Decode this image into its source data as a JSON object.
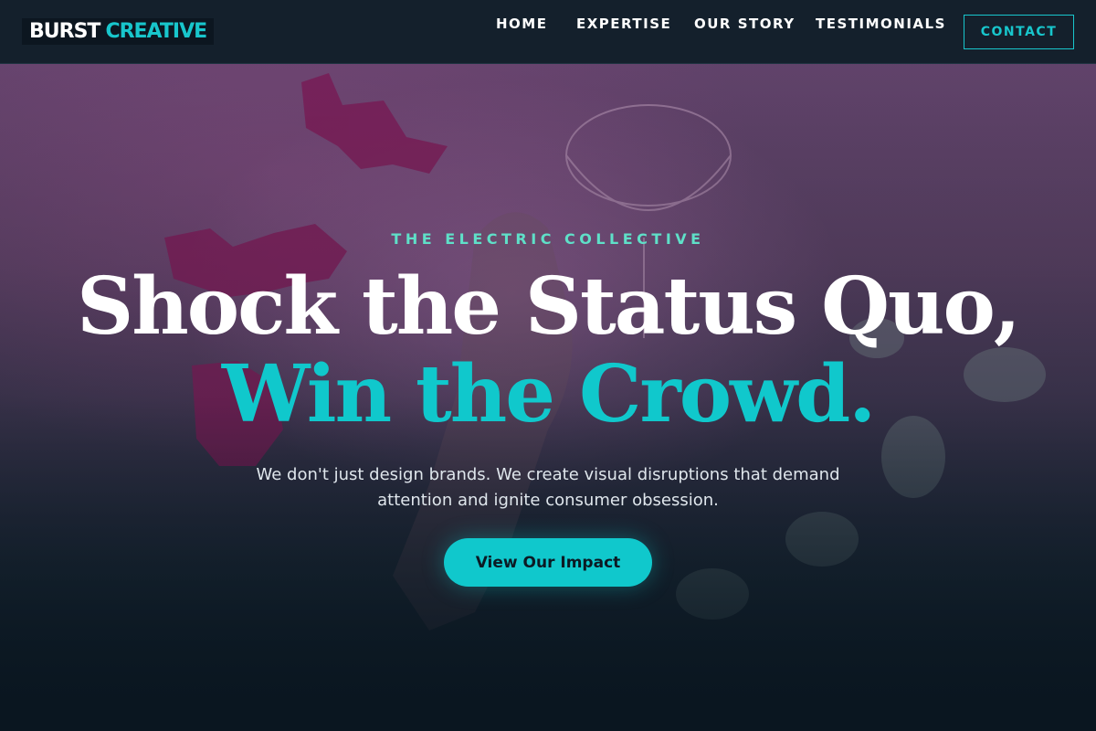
{
  "brand": {
    "logo_word1": "BURST",
    "logo_word2": "CREATIVE"
  },
  "nav": {
    "items": [
      {
        "label": "HOME"
      },
      {
        "label": "EXPERTISE"
      },
      {
        "label": "OUR STORY"
      },
      {
        "label": "TESTIMONIALS"
      }
    ],
    "contact_label": "CONTACT"
  },
  "hero": {
    "eyebrow": "THE ELECTRIC COLLECTIVE",
    "headline_line1": "Shock the Status Quo,",
    "headline_line2": "Win the Crowd.",
    "subtext": "We don't just design brands. We create visual disruptions that demand attention and ignite consumer obsession.",
    "cta_label": "View Our Impact"
  },
  "colors": {
    "accent": "#10c8cc",
    "eyebrow": "#5fe0c8",
    "header_bg": "#14202c",
    "page_bg": "#0b1722"
  }
}
